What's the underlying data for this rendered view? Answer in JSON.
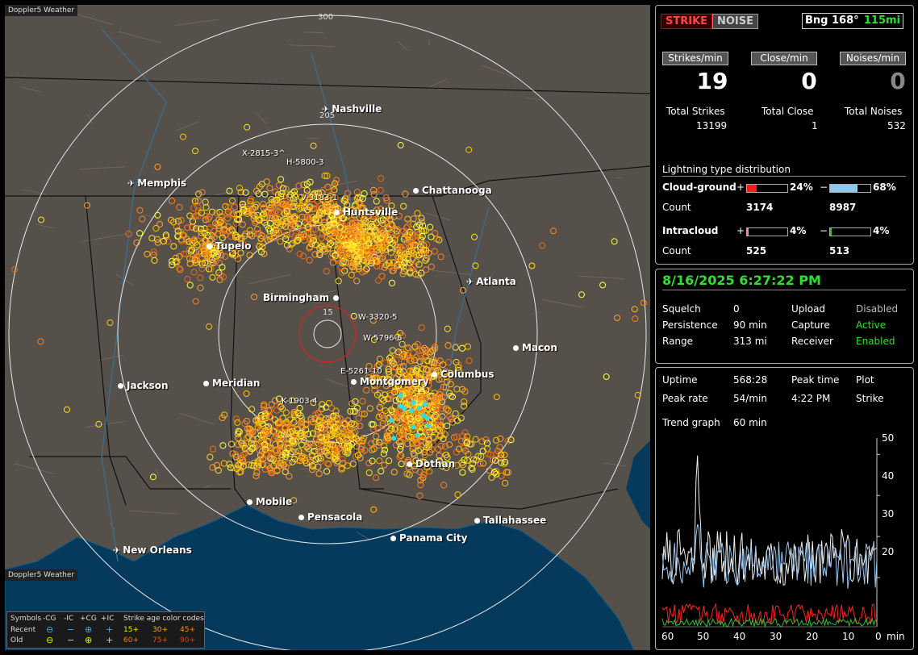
{
  "map": {
    "app_label": "Doppler5 Weather",
    "credit": "Doppler5 Weather",
    "range_labels": [
      "300",
      "205",
      "15"
    ],
    "cities": [
      {
        "name": "Nashville",
        "icon": "airport"
      },
      {
        "name": "Memphis",
        "icon": "airport"
      },
      {
        "name": "Chattanooga",
        "icon": "dot"
      },
      {
        "name": "Huntsville",
        "icon": "dot"
      },
      {
        "name": "Tupelo",
        "icon": "dot"
      },
      {
        "name": "Atlanta",
        "icon": "airport"
      },
      {
        "name": "Birmingham",
        "icon": "dot"
      },
      {
        "name": "Macon",
        "icon": "dot"
      },
      {
        "name": "Columbus",
        "icon": "dot"
      },
      {
        "name": "Jackson",
        "icon": "dot"
      },
      {
        "name": "Meridian",
        "icon": "dot"
      },
      {
        "name": "Montgomery",
        "icon": "dot"
      },
      {
        "name": "Dothan",
        "icon": "dot"
      },
      {
        "name": "Mobile",
        "icon": "dot"
      },
      {
        "name": "Pensacola",
        "icon": "dot"
      },
      {
        "name": "Tallahassee",
        "icon": "dot"
      },
      {
        "name": "Panama City",
        "icon": "dot"
      },
      {
        "name": "New Orleans",
        "icon": "airport"
      }
    ],
    "storm_labels": [
      "X-2815-3^",
      "H-5800-3",
      "V-3183-1",
      "W-3320-5",
      "W-5796-6",
      "E-5261-10",
      "K-1903-4"
    ],
    "legend": {
      "symbols_label": "Symbols",
      "cols": [
        "-CG",
        "-IC",
        "+CG",
        "+IC"
      ],
      "age_label": "Strike age color codes",
      "recent_label": "Recent",
      "old_label": "Old",
      "recent_ages": [
        "15+",
        "30+",
        "45+"
      ],
      "old_ages": [
        "60+",
        "75+",
        "90+"
      ]
    }
  },
  "header": {
    "strike_btn": "STRIKE",
    "noise_btn": "NOISE",
    "bearing": "Bng 168°",
    "distance": "115mi"
  },
  "stats": {
    "strikes_min_label": "Strikes/min",
    "close_min_label": "Close/min",
    "noises_min_label": "Noises/min",
    "strikes_min": "19",
    "close_min": "0",
    "noises_min": "0",
    "total_strikes_label": "Total Strikes",
    "total_close_label": "Total Close",
    "total_noises_label": "Total Noises",
    "total_strikes": "13199",
    "total_close": "1",
    "total_noises": "532"
  },
  "distribution": {
    "title": "Lightning type distribution",
    "cg_label": "Cloud-ground",
    "ic_label": "Intracloud",
    "count_label": "Count",
    "plus": "+",
    "minus": "−",
    "cg_pos_pct": "24%",
    "cg_neg_pct": "68%",
    "cg_pos_count": "3174",
    "cg_neg_count": "8987",
    "ic_pos_pct": "4%",
    "ic_neg_pct": "4%",
    "ic_pos_count": "525",
    "ic_neg_count": "513",
    "cg_pos_frac": 0.24,
    "cg_neg_frac": 0.68,
    "ic_pos_frac": 0.04,
    "ic_neg_frac": 0.04,
    "colors": {
      "cg_pos": "#ff1a1a",
      "cg_neg": "#8cc8f0",
      "ic_pos": "#ff80c0",
      "ic_neg": "#30c030"
    }
  },
  "status": {
    "datetime": "8/16/2025 6:27:22 PM",
    "squelch_label": "Squelch",
    "squelch": "0",
    "persistence_label": "Persistence",
    "persistence": "90 min",
    "range_label": "Range",
    "range": "313 mi",
    "upload_label": "Upload",
    "upload": "Disabled",
    "capture_label": "Capture",
    "capture": "Active",
    "receiver_label": "Receiver",
    "receiver": "Enabled"
  },
  "trend": {
    "uptime_label": "Uptime",
    "uptime": "568:28",
    "peak_time_label": "Peak time",
    "peak_time": "4:22 PM",
    "plot_label": "Plot",
    "plot": "Strike",
    "peak_rate_label": "Peak rate",
    "peak_rate": "54/min",
    "trend_label": "Trend graph",
    "trend": "60 min",
    "y_ticks": [
      "50",
      "40",
      "30",
      "20"
    ],
    "x_ticks": [
      "60",
      "50",
      "40",
      "30",
      "20",
      "10",
      "0"
    ],
    "x_unit": "min"
  }
}
